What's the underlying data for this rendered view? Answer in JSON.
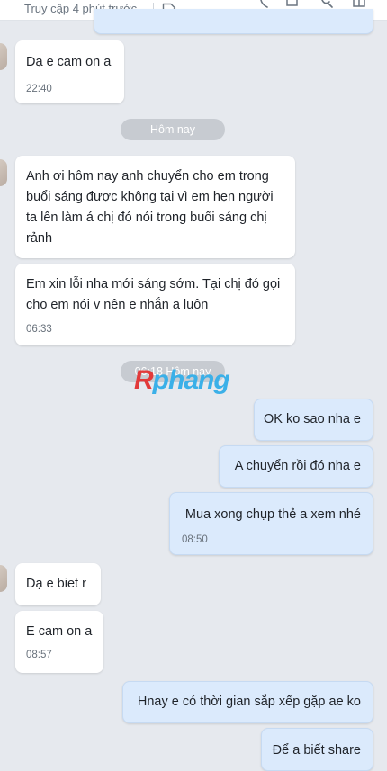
{
  "header": {
    "status": "Truy cập 4 phút trước",
    "icons": [
      "tag-icon",
      "phone-icon",
      "video-icon",
      "search-icon",
      "layout-icon"
    ]
  },
  "dividers": {
    "today": "Hôm nay",
    "time_today": "06:18 Hôm nay"
  },
  "watermark": {
    "logo_text_r": "R",
    "logo_text_rest": "phang"
  },
  "messages": [
    {
      "side": "in",
      "text": "Dạ e cam on a",
      "time": "22:40"
    },
    {
      "side": "in",
      "text": "Anh ơi hôm nay anh chuyển cho em trong buổi sáng được không tại vì em hẹn người ta lên làm á chị đó nói trong buổi sáng chị rảnh"
    },
    {
      "side": "in",
      "text": "Em xin lỗi nha  mới sáng sớm. Tại chị đó gọi cho em nói v nên e nhắn a luôn",
      "time": "06:33"
    },
    {
      "side": "out",
      "text": "OK ko sao nha e"
    },
    {
      "side": "out",
      "text": "A chuyển rồi đó nha e"
    },
    {
      "side": "out",
      "text": "Mua xong chụp thẻ a xem nhé",
      "time": "08:50"
    },
    {
      "side": "in",
      "text": "Dạ e biet r"
    },
    {
      "side": "in",
      "text": "E cam on a",
      "time": "08:57"
    },
    {
      "side": "out",
      "text": "Hnay e có thời gian sắp xếp gặp ae ko"
    },
    {
      "side": "out",
      "text": "Để a biết share"
    }
  ]
}
